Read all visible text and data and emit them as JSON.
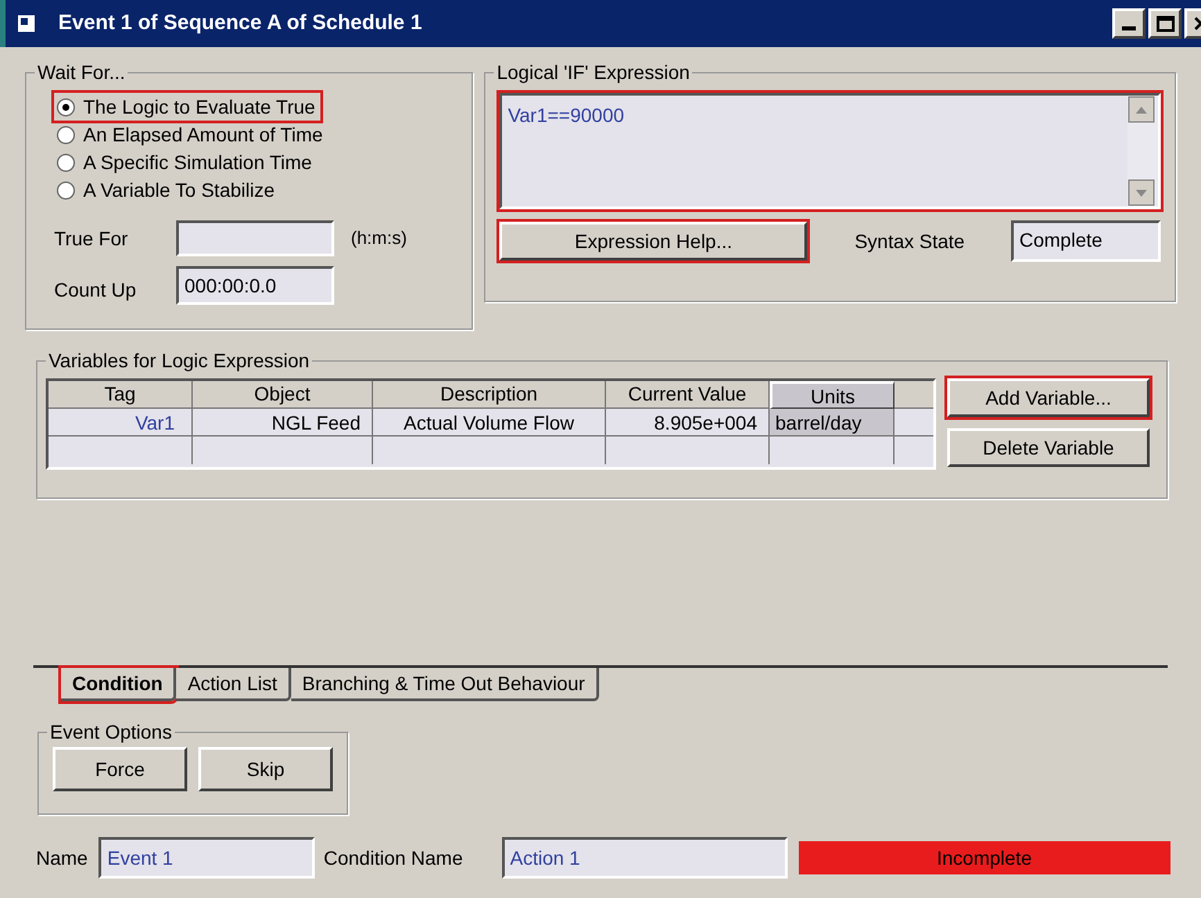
{
  "window": {
    "title": "Event 1 of Sequence A of Schedule 1"
  },
  "wait_for": {
    "title": "Wait For...",
    "options": [
      {
        "label": "The Logic to Evaluate True",
        "selected": true,
        "highlighted": true
      },
      {
        "label": "An Elapsed Amount of Time",
        "selected": false,
        "highlighted": false
      },
      {
        "label": "A Specific Simulation Time",
        "selected": false,
        "highlighted": false
      },
      {
        "label": "A Variable To Stabilize",
        "selected": false,
        "highlighted": false
      }
    ],
    "true_for": {
      "label": "True For",
      "units": "(h:m:s)"
    },
    "count_up": {
      "label": "Count Up",
      "value": "000:00:0.0"
    }
  },
  "logical_if": {
    "title": "Logical 'IF' Expression",
    "expression": "Var1==90000",
    "highlighted": true,
    "help_button": {
      "label": "Expression Help...",
      "highlighted": true
    },
    "syntax_state": {
      "label": "Syntax State",
      "value": "Complete"
    }
  },
  "variables": {
    "title": "Variables for Logic Expression",
    "columns": [
      {
        "label": "Tag",
        "selected": false
      },
      {
        "label": "Object",
        "selected": false
      },
      {
        "label": "Description",
        "selected": false
      },
      {
        "label": "Current Value",
        "selected": false
      },
      {
        "label": "Units",
        "selected": true
      }
    ],
    "rows": [
      [
        "Var1",
        "NGL Feed",
        "Actual Volume Flow",
        "8.905e+004",
        "barrel/day"
      ]
    ],
    "buttons": [
      {
        "label": "Add Variable...",
        "highlighted": true
      },
      {
        "label": "Delete Variable",
        "highlighted": false
      }
    ]
  },
  "tabs": [
    {
      "label": "Condition",
      "selected": true,
      "highlighted": true
    },
    {
      "label": "Action List",
      "selected": false,
      "highlighted": false
    },
    {
      "label": "Branching & Time Out Behaviour",
      "selected": false,
      "highlighted": false
    }
  ],
  "event_options": {
    "title": "Event Options",
    "buttons": [
      "Force",
      "Skip"
    ]
  },
  "footer": {
    "name": {
      "label": "Name",
      "value": "Event 1"
    },
    "condition_name": {
      "label": "Condition Name",
      "value": "Action 1"
    },
    "status": {
      "text": "Incomplete",
      "kind": "error"
    }
  }
}
